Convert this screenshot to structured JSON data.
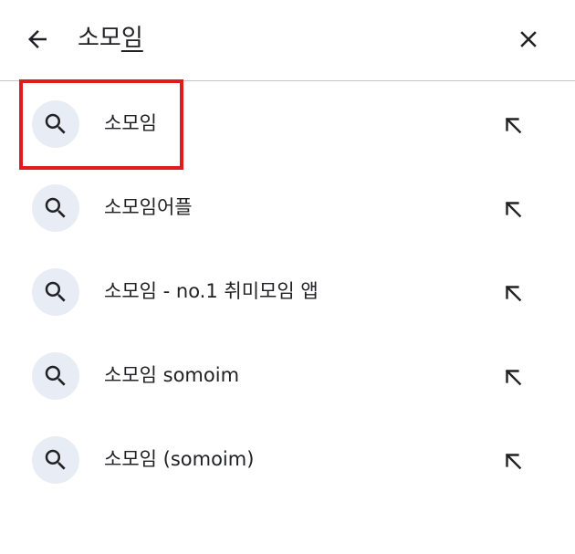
{
  "search": {
    "query_prefix": "소모",
    "query_underlined": "임"
  },
  "suggestions": [
    {
      "label": "소모임"
    },
    {
      "label": "소모임어플"
    },
    {
      "label": "소모임 - no.1 취미모임 앱"
    },
    {
      "label": "소모임 somoim"
    },
    {
      "label": "소모임 (somoim)"
    }
  ],
  "icons": {
    "back": "arrow-back-icon",
    "close": "close-icon",
    "search": "search-icon",
    "fill": "arrow-up-left-icon"
  },
  "colors": {
    "highlight": "#e01b1b",
    "icon_circle": "#e8ecf5",
    "text": "#202124"
  }
}
